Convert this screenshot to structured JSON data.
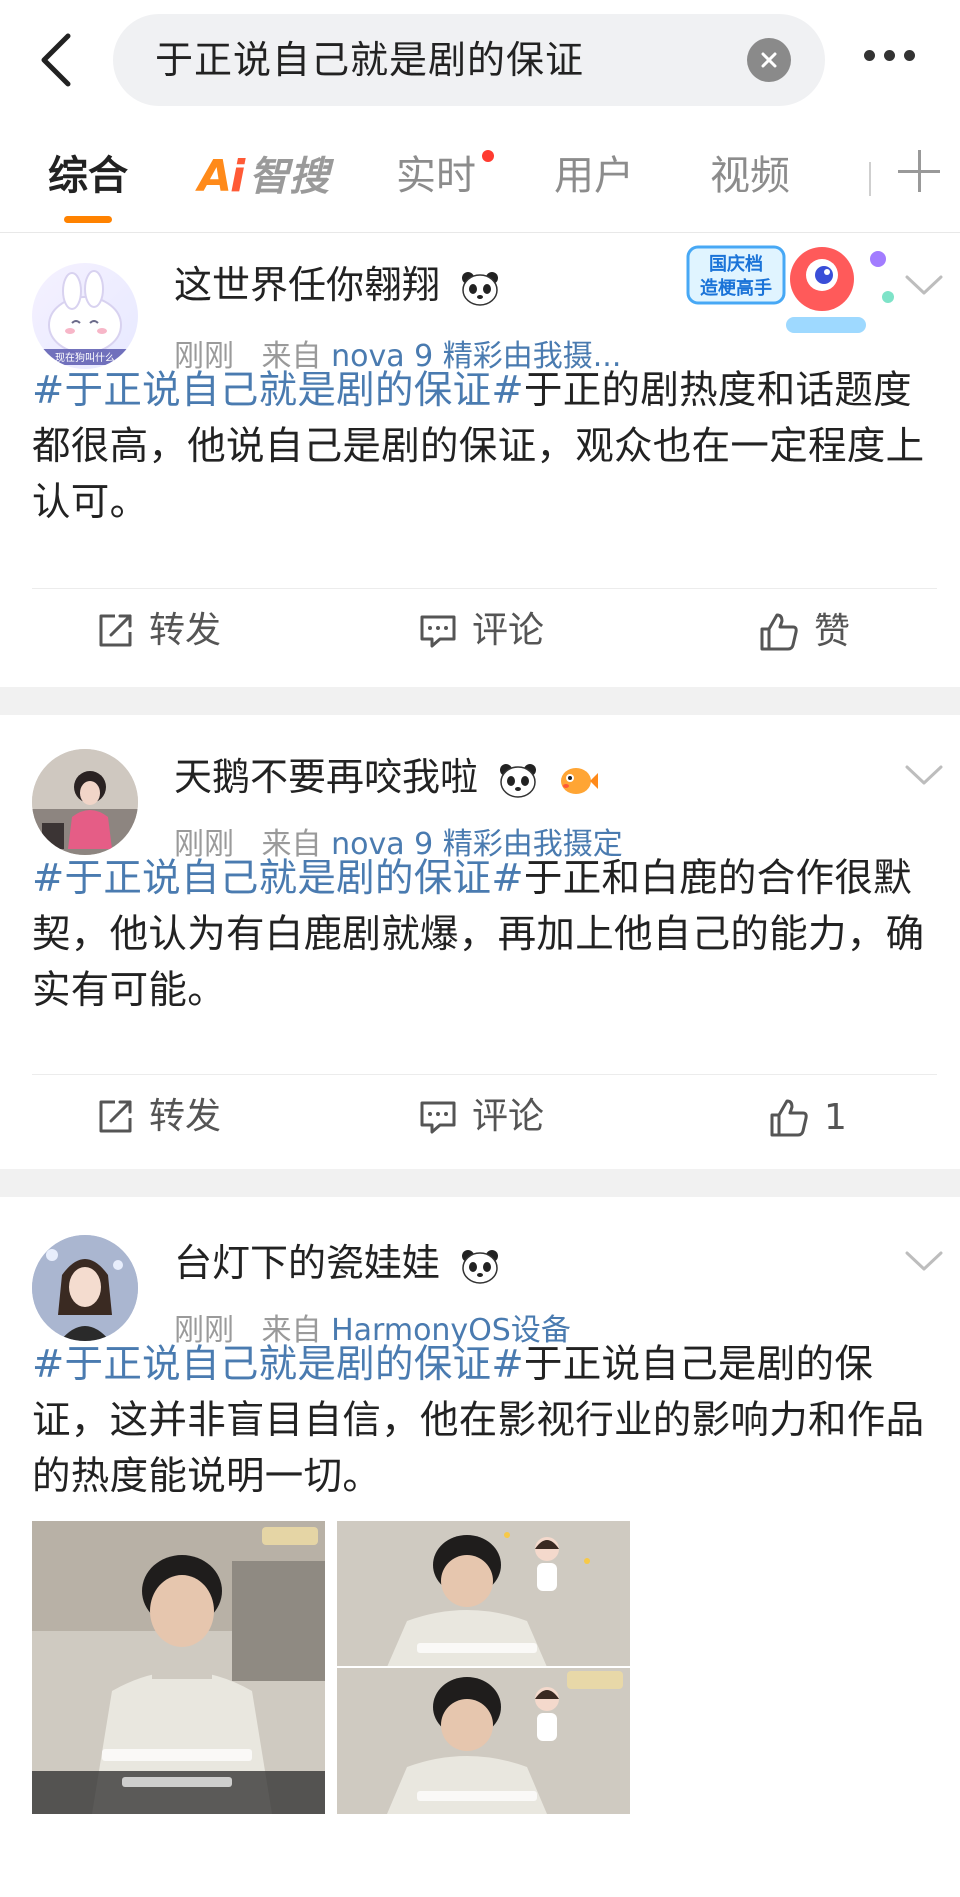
{
  "search": {
    "query": "于正说自己就是剧的保证"
  },
  "tabs": [
    {
      "label": "综合"
    },
    {
      "label": "智搜",
      "logo": "Ai"
    },
    {
      "label": "实时"
    },
    {
      "label": "用户"
    },
    {
      "label": "视频"
    }
  ],
  "posts": [
    {
      "username": "这世界任你翱翔",
      "time": "刚刚",
      "from_label": "来自",
      "device": "nova 9 精彩由我摄...",
      "hashtag": "#于正说自己就是剧的保证#",
      "body": "于正的剧热度和话题度都很高，他说自己是剧的保证，观众也在一定程度上认可。",
      "badge_text": [
        "国庆档",
        "造梗高手"
      ],
      "avatar_text": "现在狗叫什么",
      "actions": {
        "repost": "转发",
        "comment": "评论",
        "like": "赞"
      }
    },
    {
      "username": "天鹅不要再咬我啦",
      "time": "刚刚",
      "from_label": "来自",
      "device": "nova 9 精彩由我摄定",
      "hashtag": "#于正说自己就是剧的保证#",
      "body": "于正和白鹿的合作很默契，他认为有白鹿剧就爆，再加上他自己的能力，确实有可能。",
      "actions": {
        "repost": "转发",
        "comment": "评论",
        "like": "1"
      }
    },
    {
      "username": "台灯下的瓷娃娃",
      "time": "刚刚",
      "from_label": "来自",
      "device": "HarmonyOS设备",
      "hashtag": "#于正说自己就是剧的保证#",
      "body": "于正说自己是剧的保证，这并非盲目自信，他在影视行业的影响力和作品的热度能说明一切。"
    }
  ],
  "colors": {
    "accent": "#ff8200",
    "link": "#4a7bb0",
    "notification_dot": "#ff3b30",
    "separator": "#f1f1f1"
  }
}
